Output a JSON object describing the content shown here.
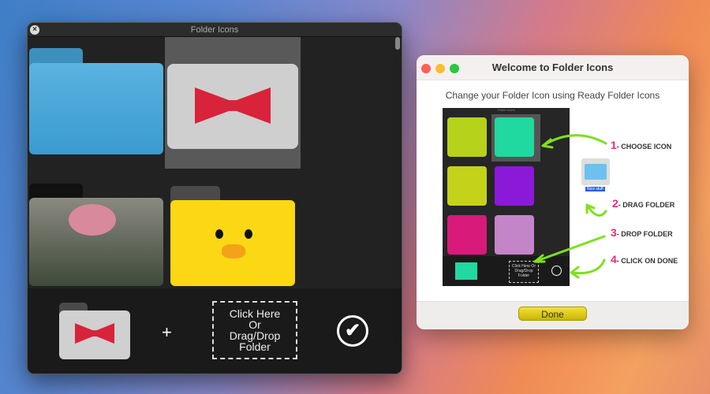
{
  "folder_icons_window": {
    "title": "Folder Icons",
    "drop_zone": [
      "Click Here",
      "Or",
      "Drag/Drop",
      "Folder"
    ],
    "plus": "+",
    "done_check": "✔",
    "close": "×"
  },
  "welcome_window": {
    "title": "Welcome to Folder Icons",
    "subtitle": "Change your Folder Icon using Ready Folder Icons",
    "steps": [
      {
        "n": "1",
        "label": "- CHOOSE ICON"
      },
      {
        "n": "2",
        "label": "- DRAG FOLDER"
      },
      {
        "n": "3",
        "label": "- DROP FOLDER"
      },
      {
        "n": "4",
        "label": "- CLICK ON DONE"
      }
    ],
    "folder_name": "Nice stuff",
    "mini_title": "Folder Icons",
    "mini_drop": "Click Here Or Drag/Drop Folder",
    "done": "Done"
  },
  "colors": {
    "close": "#ff5f57",
    "minimize": "#febc2e",
    "zoom": "#28c840",
    "accent_step": "#ee2a77"
  }
}
